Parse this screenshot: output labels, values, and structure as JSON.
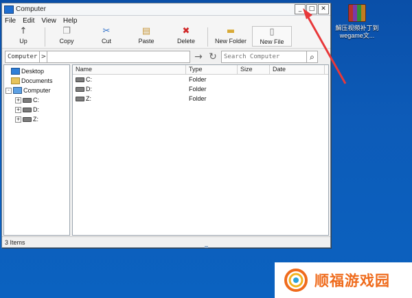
{
  "window": {
    "title": "Computer",
    "buttons": {
      "minimize": "_",
      "maximize": "□",
      "close": "✕"
    }
  },
  "menu": [
    "File",
    "Edit",
    "View",
    "Help"
  ],
  "toolbar": {
    "up": "Up",
    "copy": "Copy",
    "cut": "Cut",
    "paste": "Paste",
    "delete": "Delete",
    "new_folder": "New Folder",
    "new_file": "New File"
  },
  "address": {
    "crumb": "Computer",
    "arrow": ">",
    "search_placeholder": "Search Computer"
  },
  "tree": [
    {
      "label": "Desktop",
      "icon": "desktop-icon",
      "expander": ""
    },
    {
      "label": "Documents",
      "icon": "documents-icon",
      "expander": ""
    },
    {
      "label": "Computer",
      "icon": "computer-icon",
      "expander": "-"
    },
    {
      "label": "C:",
      "icon": "drive-icon",
      "expander": "+"
    },
    {
      "label": "D:",
      "icon": "drive-icon",
      "expander": "+"
    },
    {
      "label": "Z:",
      "icon": "drive-icon",
      "expander": "+"
    }
  ],
  "list": {
    "columns": [
      "Name",
      "Type",
      "Size",
      "Date"
    ],
    "rows": [
      {
        "name": "C:",
        "type": "Folder"
      },
      {
        "name": "D:",
        "type": "Folder"
      },
      {
        "name": "Z:",
        "type": "Folder"
      }
    ]
  },
  "status": "3 Items",
  "desktop_icon": {
    "caption": "解压视频补丁到wegame文..."
  },
  "watermark": {
    "text": "顺福游戏园"
  },
  "colors": {
    "desktop": "#0b5cb8",
    "annotation_arrow": "#e8383a",
    "watermark_text": "#ef6b1c"
  }
}
